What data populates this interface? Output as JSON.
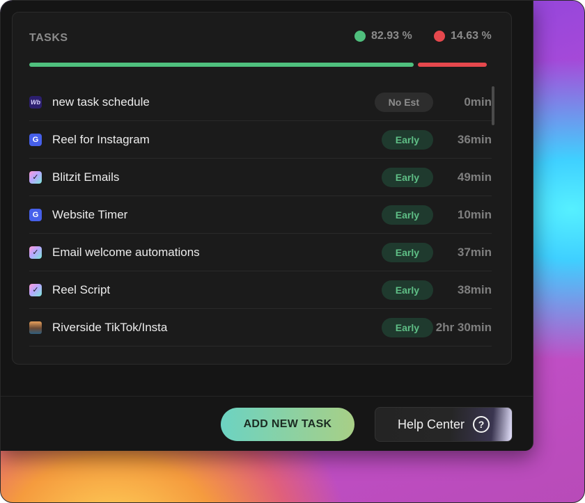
{
  "tasks_panel": {
    "title": "TASKS",
    "stats": {
      "green_percent": "82.93 %",
      "red_percent": "14.63 %"
    },
    "progress": {
      "green_fraction": 0.8293,
      "red_fraction": 0.1463
    },
    "colors": {
      "green": "#4fc07e",
      "red": "#e6484d"
    }
  },
  "tasks": [
    {
      "icon": "webflow-icon",
      "icon_glyph": "Wb",
      "name": "new task schedule",
      "status": "No Est",
      "duration": "0min"
    },
    {
      "icon": "google-icon",
      "icon_glyph": "G",
      "name": "Reel for Instagram",
      "status": "Early",
      "duration": "36min"
    },
    {
      "icon": "checkbox-icon",
      "icon_glyph": "✓",
      "name": "Blitzit Emails",
      "status": "Early",
      "duration": "49min"
    },
    {
      "icon": "google-icon",
      "icon_glyph": "G",
      "name": "Website Timer",
      "status": "Early",
      "duration": "10min"
    },
    {
      "icon": "checkbox-icon",
      "icon_glyph": "✓",
      "name": "Email welcome automations",
      "status": "Early",
      "duration": "37min"
    },
    {
      "icon": "checkbox-icon",
      "icon_glyph": "✓",
      "name": "Reel Script",
      "status": "Early",
      "duration": "38min"
    },
    {
      "icon": "avatar-icon",
      "icon_glyph": "",
      "name": "Riverside TikTok/Insta",
      "status": "Early",
      "duration": "2hr 30min"
    }
  ],
  "footer": {
    "add_task_label": "ADD NEW TASK",
    "help_label": "Help Center",
    "help_icon_glyph": "?"
  }
}
